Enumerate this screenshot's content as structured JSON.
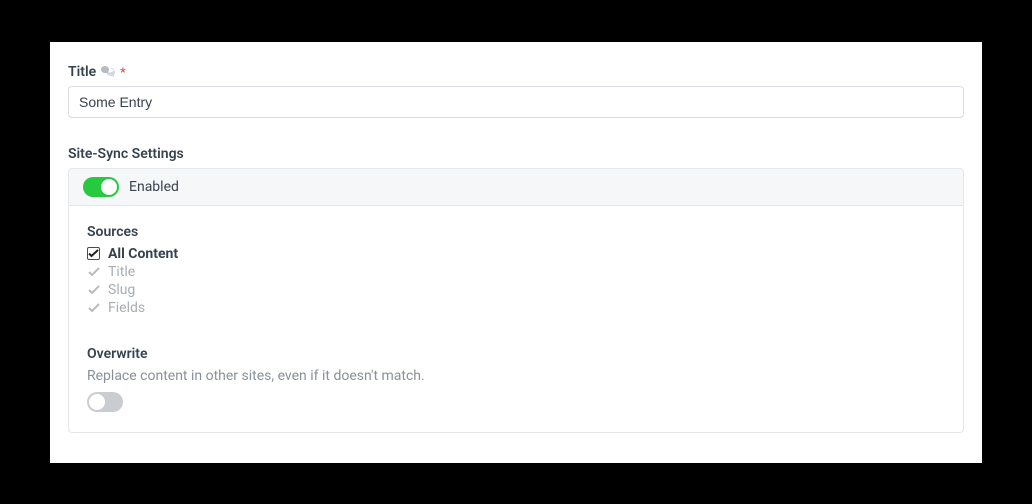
{
  "title": {
    "label": "Title",
    "required_mark": "*",
    "value": "Some Entry"
  },
  "site_sync": {
    "section_label": "Site-Sync Settings",
    "enabled_label": "Enabled",
    "enabled": true,
    "sources": {
      "label": "Sources",
      "all_content": {
        "label": "All Content",
        "checked": true
      },
      "items": [
        {
          "label": "Title"
        },
        {
          "label": "Slug"
        },
        {
          "label": "Fields"
        }
      ]
    },
    "overwrite": {
      "label": "Overwrite",
      "description": "Replace content in other sites, even if it doesn't match.",
      "enabled": false
    }
  }
}
